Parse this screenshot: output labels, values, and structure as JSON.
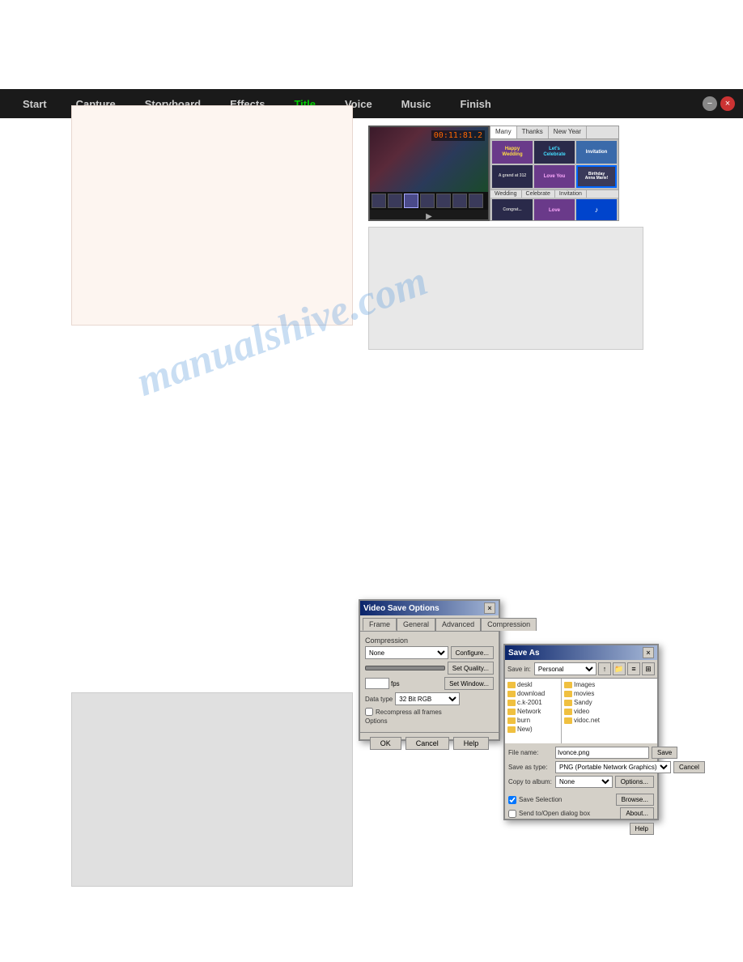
{
  "navbar": {
    "items": [
      {
        "id": "start",
        "label": "Start",
        "active": false
      },
      {
        "id": "capture",
        "label": "Capture",
        "active": false
      },
      {
        "id": "storyboard",
        "label": "Storyboard",
        "active": false
      },
      {
        "id": "effects",
        "label": "Effects",
        "active": false
      },
      {
        "id": "title",
        "label": "Title",
        "active": true
      },
      {
        "id": "voice",
        "label": "Voice",
        "active": false
      },
      {
        "id": "music",
        "label": "Music",
        "active": false
      },
      {
        "id": "finish",
        "label": "Finish",
        "active": false
      }
    ],
    "min_label": "−",
    "close_label": "×"
  },
  "video_thumbnail": {
    "timecode": "00:11:81.2"
  },
  "title_panel": {
    "tabs": [
      "Many",
      "Thanks",
      "New Year"
    ],
    "cells": [
      {
        "text": "Happy\nWedding",
        "style": "purple"
      },
      {
        "text": "Let's\nCelebrate",
        "style": "dark"
      },
      {
        "text": "Invitation",
        "style": "blue"
      },
      {
        "text": "A grand at 312",
        "style": "dark"
      },
      {
        "text": "Love You",
        "style": "purple"
      },
      {
        "text": "Birthday\nAnna Marie!",
        "style": "selected"
      },
      {
        "text": "Congrat...",
        "style": "dark"
      },
      {
        "text": "Love",
        "style": "purple"
      },
      {
        "text": "♪",
        "style": "blue"
      }
    ],
    "bottom_tabs": [
      "Wedding",
      "Celebrate",
      "Invitation"
    ],
    "bottom_tabs2": [
      "Congrat...",
      "Love",
      ""
    ]
  },
  "watermark": {
    "text": "manualshive.com"
  },
  "dialog_video_save": {
    "title": "Video Save Options",
    "tabs": [
      "Frame",
      "General",
      "Advanced",
      "Compression"
    ],
    "active_tab": "Frame",
    "compression_label": "Compression",
    "compression_value": "None",
    "configure_btn": "Configure...",
    "quality_btn": "Set Quality...",
    "keyframe_btn": "Set Window...",
    "data_type_label": "Data type",
    "data_type_value": "32 Bit RGB",
    "checkbox_label": "Recompress all frames",
    "options_label": "Options",
    "cancel_btn": "Cancel",
    "fps_label": "fps",
    "fps_value": "",
    "depth_value": "",
    "ok_btn": "OK",
    "cancel_footer_btn": "Cancel",
    "help_btn": "Help"
  },
  "dialog_save_as": {
    "title": "Save As",
    "location_label": "Save in:",
    "location_value": "Personal",
    "folders": [
      {
        "name": "deskl"
      },
      {
        "name": "download"
      },
      {
        "name": "c.k-2001"
      },
      {
        "name": "Network"
      },
      {
        "name": "burn"
      },
      {
        "name": "New)"
      }
    ],
    "files": [
      {
        "name": "Images",
        "type": "folder"
      },
      {
        "name": "movies",
        "type": "folder"
      },
      {
        "name": "Sandy",
        "type": "folder"
      },
      {
        "name": "video",
        "type": "folder"
      },
      {
        "name": "vidoc.net",
        "type": "folder"
      }
    ],
    "filename_label": "File name:",
    "filename_value": "Ivonce.png",
    "saveas_label": "Save as type:",
    "saveas_value": "PNG (Portable Network Graphics)",
    "color_label": "Copy to album:",
    "color_value": "None",
    "save_selection_checked": true,
    "save_selection_label": "Save Selection",
    "bridge_label": "Send to/Open dialog box",
    "save_btn": "Save",
    "cancel_btn": "Cancel",
    "options_btn": "Options...",
    "browse_btn": "Browse...",
    "about_btn": "About...",
    "help_btn": "Help"
  }
}
